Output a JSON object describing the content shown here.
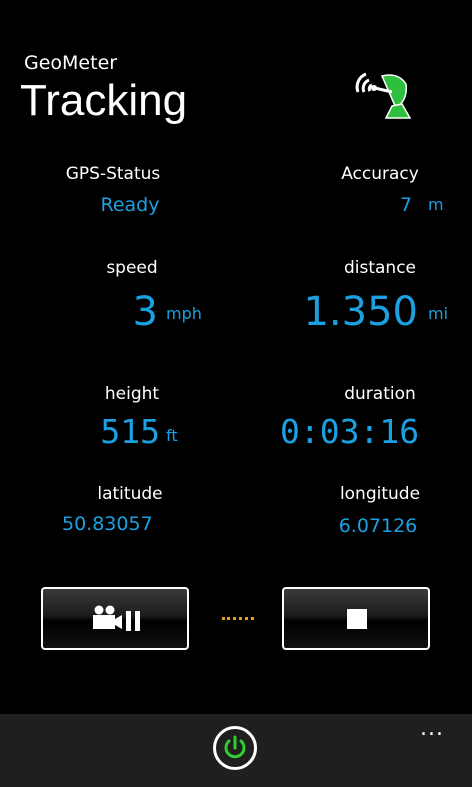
{
  "app": {
    "name": "GeoMeter",
    "page_title": "Tracking"
  },
  "gps_status": {
    "label": "GPS-Status",
    "value": "Ready"
  },
  "accuracy": {
    "label": "Accuracy",
    "value": "7",
    "unit": "m"
  },
  "speed": {
    "label": "speed",
    "value": "3",
    "unit": "mph"
  },
  "distance": {
    "label": "distance",
    "value": "1.350",
    "unit": "mi"
  },
  "height": {
    "label": "height",
    "value": "515",
    "unit": "ft"
  },
  "duration": {
    "label": "duration",
    "value": "0:03:16"
  },
  "latitude": {
    "label": "latitude",
    "value": "50.83057"
  },
  "longitude": {
    "label": "longitude",
    "value": "6.07126"
  },
  "controls": {
    "pause_icon": "video-pause-icon",
    "stop_icon": "stop-icon"
  },
  "appbar": {
    "power_icon": "power-icon",
    "more_label": "..."
  },
  "colors": {
    "accent": "#1ba1e2",
    "gps_icon": "#2fbf3f",
    "power": "#33cc33",
    "dash": "#e3a21a"
  }
}
